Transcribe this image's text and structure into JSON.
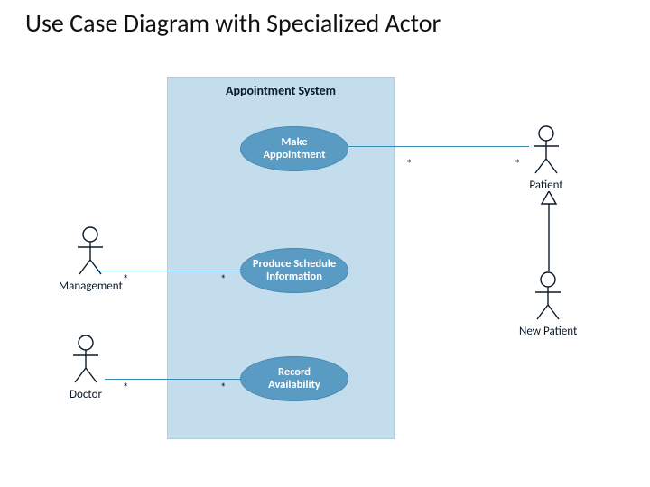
{
  "title": "Use Case Diagram with Specialized Actor",
  "system_name": "Appointment System",
  "usecases": {
    "make": "Make\nAppointment",
    "produce": "Produce Schedule\nInformation",
    "record": "Record\nAvailability"
  },
  "actors": {
    "patient": "Patient",
    "new_patient": "New Patient",
    "management": "Management",
    "doctor": "Doctor"
  },
  "mult": "*"
}
